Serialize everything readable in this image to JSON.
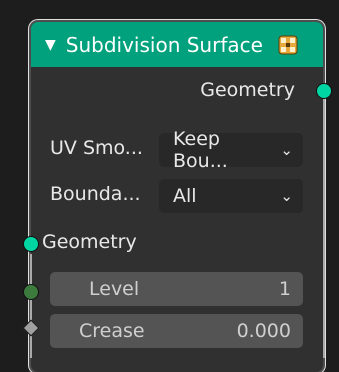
{
  "node": {
    "title": "Subdivision Surface",
    "collapse_icon": "triangle-down-icon",
    "header_icon": "node-group-icon",
    "output_geometry": "Geometry",
    "uv_smooth": {
      "label": "UV Smo...",
      "value": "Keep Bou..."
    },
    "boundary": {
      "label": "Bounda...",
      "value": "All"
    },
    "input_geometry": "Geometry",
    "level": {
      "label": "Level",
      "value": "1"
    },
    "crease": {
      "label": "Crease",
      "value": "0.000"
    }
  },
  "colors": {
    "header": "#00a17c",
    "geometry_socket": "#00d6a3",
    "int_socket": "#3d7a3d",
    "float_socket": "#a1a1a1"
  }
}
